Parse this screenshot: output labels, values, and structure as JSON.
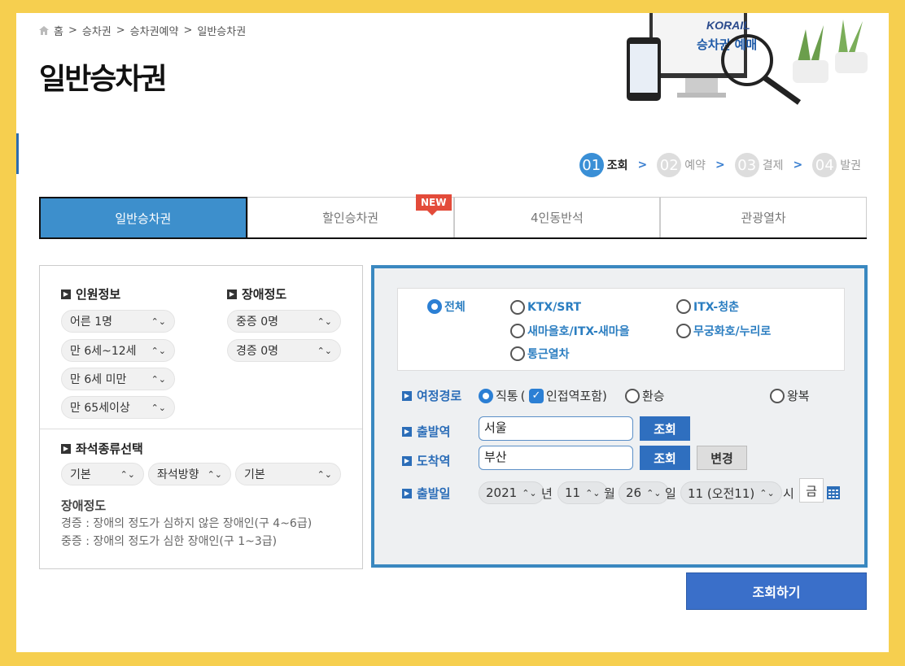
{
  "breadcrumb": {
    "home": "홈",
    "items": [
      "승차권",
      "승차권예약",
      "일반승차권"
    ],
    "sep": ">"
  },
  "page_title": "일반승차권",
  "hero": {
    "logo_text": "KORAIL",
    "caption": "승차권 예매"
  },
  "steps": [
    {
      "num": "01",
      "label": "조회",
      "active": true
    },
    {
      "num": "02",
      "label": "예약",
      "active": false
    },
    {
      "num": "03",
      "label": "결제",
      "active": false
    },
    {
      "num": "04",
      "label": "발권",
      "active": false
    }
  ],
  "step_arrow": ">",
  "tabs": [
    {
      "label": "일반승차권",
      "active": true
    },
    {
      "label": "할인승차권",
      "badge": "NEW"
    },
    {
      "label": "4인동반석"
    },
    {
      "label": "관광열차"
    }
  ],
  "passenger": {
    "title": "인원정보",
    "items": [
      "어른 1명",
      "만 6세~12세",
      "만 6세 미만",
      "만 65세이상"
    ]
  },
  "disability": {
    "title": "장애정도",
    "items": [
      "중증 0명",
      "경증 0명"
    ]
  },
  "seat": {
    "title": "좌석종류선택",
    "options": [
      "기본",
      "좌석방향",
      "기본"
    ]
  },
  "disability_note": {
    "title": "장애정도",
    "lines": [
      "경증 : 장애의 정도가 심하지 않은 장애인(구 4~6급)",
      "중증 : 장애의 정도가 심한 장애인(구 1~3급)"
    ]
  },
  "train_types": [
    {
      "label": "전체",
      "selected": true
    },
    {
      "label": "KTX/SRT"
    },
    {
      "label": "ITX-청춘"
    },
    {
      "label": "새마을호/ITX-새마을"
    },
    {
      "label": "무궁화호/누리로"
    },
    {
      "label": "통근열차"
    }
  ],
  "route": {
    "label": "여정경로",
    "direct": "직통",
    "direct_paren_open": "(",
    "adjacent": "인접역포함)",
    "transfer": "환승",
    "roundtrip": "왕복"
  },
  "departure": {
    "label": "출발역",
    "value": "서울",
    "button": "조회"
  },
  "arrival": {
    "label": "도착역",
    "value": "부산",
    "button": "조회",
    "swap": "변경"
  },
  "date": {
    "label": "출발일",
    "year": "2021",
    "year_unit": "년",
    "month": "11",
    "month_unit": "월",
    "day": "26",
    "day_unit": "일",
    "hour": "11 (오전11)",
    "hour_unit": "시",
    "weekday": "금"
  },
  "submit": "조회하기",
  "colors": {
    "accent": "#3a88c0",
    "tab_active": "#3d8fcc",
    "frame": "#f6cf4f",
    "badge": "#e34b3a"
  }
}
